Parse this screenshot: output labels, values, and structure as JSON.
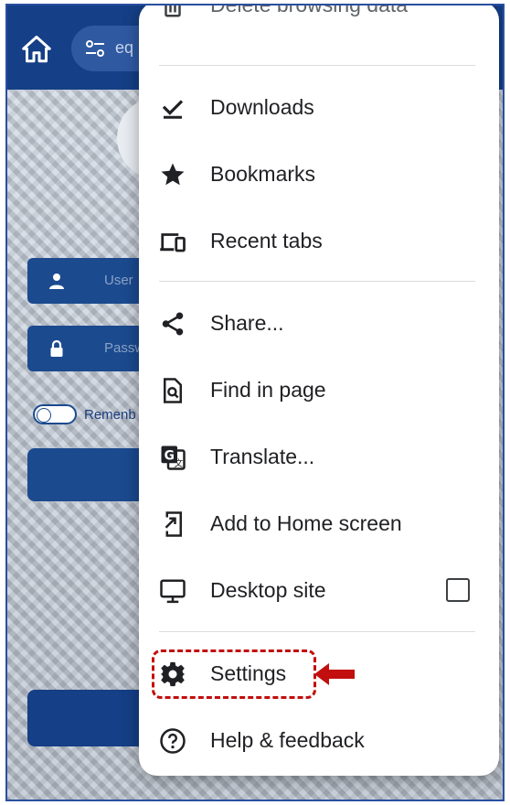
{
  "browser": {
    "url_text": "eq"
  },
  "login_page": {
    "username_placeholder": "User",
    "password_placeholder": "Passw",
    "remember_label": "Remenb"
  },
  "menu": {
    "partial_top_item": "Delete browsing data",
    "items": [
      {
        "label": "Downloads",
        "icon": "download-icon"
      },
      {
        "label": "Bookmarks",
        "icon": "star-icon"
      },
      {
        "label": "Recent tabs",
        "icon": "devices-icon"
      },
      {
        "label": "Share...",
        "icon": "share-icon"
      },
      {
        "label": "Find in page",
        "icon": "find-in-page-icon"
      },
      {
        "label": "Translate...",
        "icon": "translate-icon"
      },
      {
        "label": "Add to Home screen",
        "icon": "add-to-home-icon"
      },
      {
        "label": "Desktop site",
        "icon": "monitor-icon",
        "checked": false
      },
      {
        "label": "Settings",
        "icon": "gear-icon",
        "highlighted": true
      },
      {
        "label": "Help & feedback",
        "icon": "help-icon"
      }
    ]
  },
  "colors": {
    "brand_blue": "#153f86",
    "highlight_red": "#c20e0e",
    "menu_text": "#202124"
  }
}
